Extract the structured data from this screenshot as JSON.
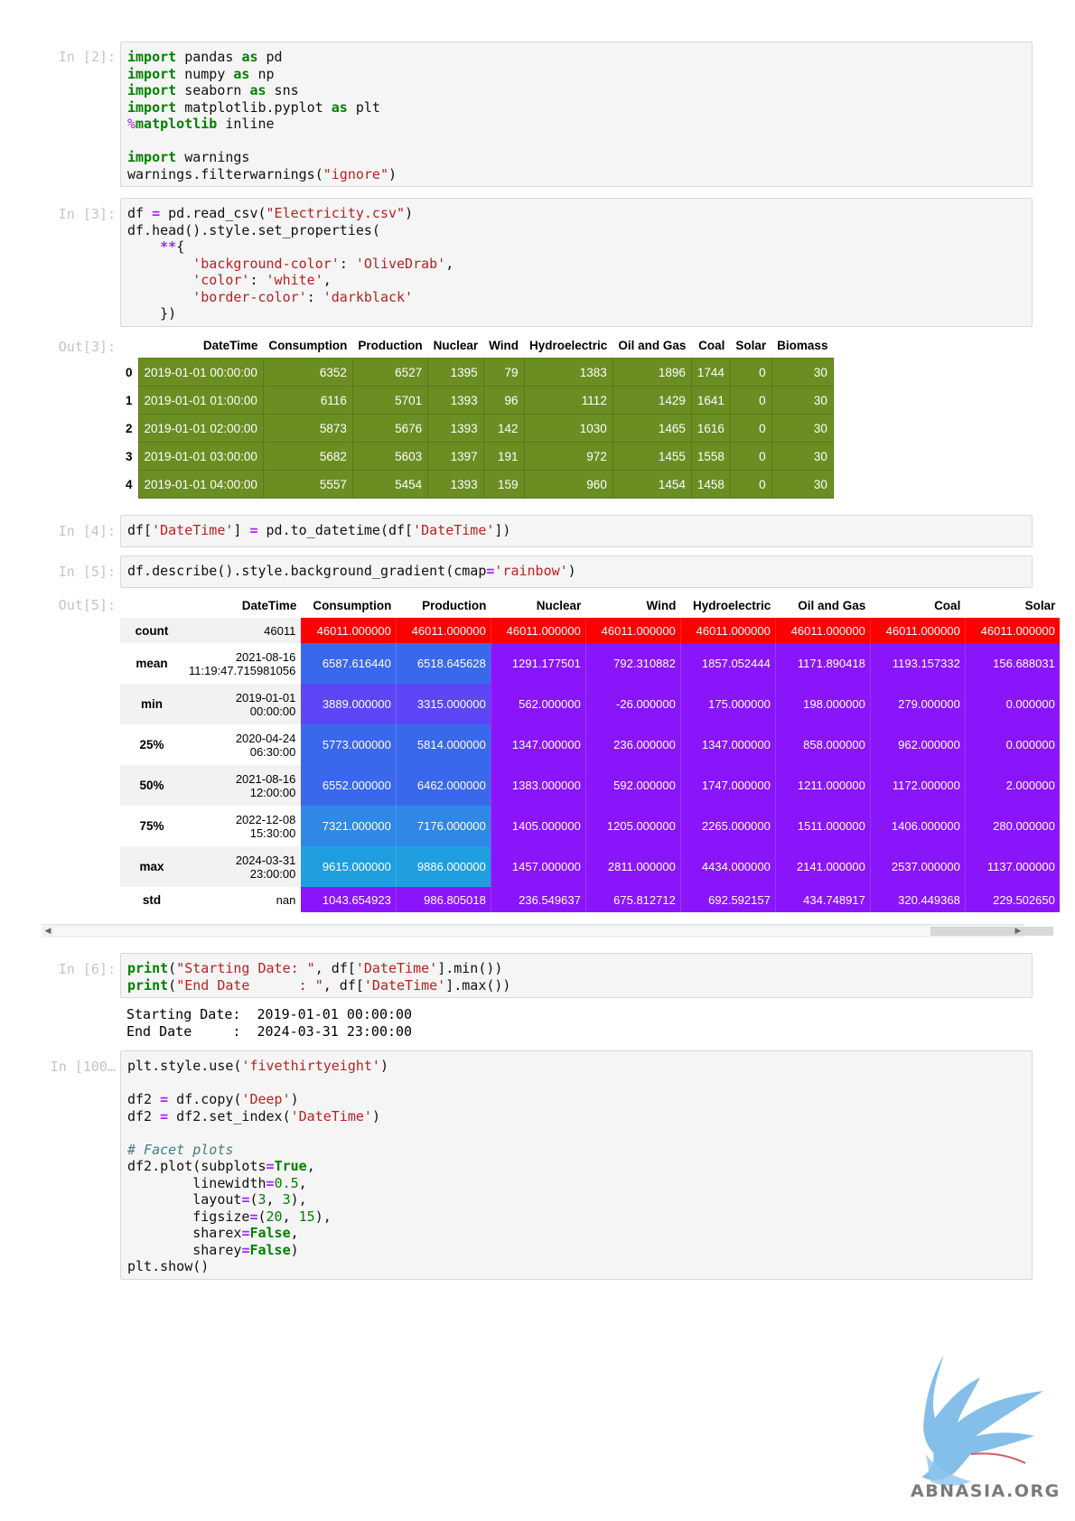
{
  "cells": {
    "in2": {
      "prompt": "In [2]:"
    },
    "in3": {
      "prompt": "In [3]:"
    },
    "out3": {
      "prompt": "Out[3]:"
    },
    "in4": {
      "prompt": "In [4]:"
    },
    "in5": {
      "prompt": "In [5]:"
    },
    "out5": {
      "prompt": "Out[5]:"
    },
    "in6": {
      "prompt": "In [6]:"
    },
    "in100": {
      "prompt": "In [100…"
    }
  },
  "head_table": {
    "columns": [
      "",
      "DateTime",
      "Consumption",
      "Production",
      "Nuclear",
      "Wind",
      "Hydroelectric",
      "Oil and Gas",
      "Coal",
      "Solar",
      "Biomass"
    ],
    "rows": [
      [
        "0",
        "2019-01-01 00:00:00",
        "6352",
        "6527",
        "1395",
        "79",
        "1383",
        "1896",
        "1744",
        "0",
        "30"
      ],
      [
        "1",
        "2019-01-01 01:00:00",
        "6116",
        "5701",
        "1393",
        "96",
        "1112",
        "1429",
        "1641",
        "0",
        "30"
      ],
      [
        "2",
        "2019-01-01 02:00:00",
        "5873",
        "5676",
        "1393",
        "142",
        "1030",
        "1465",
        "1616",
        "0",
        "30"
      ],
      [
        "3",
        "2019-01-01 03:00:00",
        "5682",
        "5603",
        "1397",
        "191",
        "972",
        "1455",
        "1558",
        "0",
        "30"
      ],
      [
        "4",
        "2019-01-01 04:00:00",
        "5557",
        "5454",
        "1393",
        "159",
        "960",
        "1454",
        "1458",
        "0",
        "30"
      ]
    ],
    "background_color": "#6b8e23",
    "text_color": "#ffffff"
  },
  "describe_table": {
    "columns": [
      "",
      "DateTime",
      "Consumption",
      "Production",
      "Nuclear",
      "Wind",
      "Hydroelectric",
      "Oil and Gas",
      "Coal",
      "Solar"
    ],
    "rows": [
      {
        "label": "count",
        "datetime": "46011",
        "values": [
          "46011.000000",
          "46011.000000",
          "46011.000000",
          "46011.000000",
          "46011.000000",
          "46011.000000",
          "46011.000000",
          "46011.000000"
        ],
        "colors": [
          "#ff0000",
          "#ff0000",
          "#ff0000",
          "#ff0000",
          "#ff0000",
          "#ff0000",
          "#ff0000",
          "#ff0000"
        ]
      },
      {
        "label": "mean",
        "datetime": "2021-08-16\n11:19:47.715981056",
        "values": [
          "6587.616440",
          "6518.645628",
          "1291.177501",
          "792.310882",
          "1857.052444",
          "1171.890418",
          "1193.157332",
          "156.688031"
        ],
        "colors": [
          "#3a68ec",
          "#3a68ec",
          "#8a15fb",
          "#8a15fb",
          "#8a15fb",
          "#8a15fb",
          "#8a15fb",
          "#8a15fb"
        ]
      },
      {
        "label": "min",
        "datetime": "2019-01-01\n00:00:00",
        "values": [
          "3889.000000",
          "3315.000000",
          "562.000000",
          "-26.000000",
          "175.000000",
          "198.000000",
          "279.000000",
          "0.000000"
        ],
        "colors": [
          "#5c46f6",
          "#5c46f6",
          "#8a15fb",
          "#8a15fb",
          "#8a15fb",
          "#8a15fb",
          "#8a15fb",
          "#8a15fb"
        ]
      },
      {
        "label": "25%",
        "datetime": "2020-04-24\n06:30:00",
        "values": [
          "5773.000000",
          "5814.000000",
          "1347.000000",
          "236.000000",
          "1347.000000",
          "858.000000",
          "962.000000",
          "0.000000"
        ],
        "colors": [
          "#3a68ec",
          "#3a68ec",
          "#8a15fb",
          "#8a15fb",
          "#8a15fb",
          "#8a15fb",
          "#8a15fb",
          "#8a15fb"
        ]
      },
      {
        "label": "50%",
        "datetime": "2021-08-16\n12:00:00",
        "values": [
          "6552.000000",
          "6462.000000",
          "1383.000000",
          "592.000000",
          "1747.000000",
          "1211.000000",
          "1172.000000",
          "2.000000"
        ],
        "colors": [
          "#3a68ec",
          "#3a68ec",
          "#8a15fb",
          "#8a15fb",
          "#8a15fb",
          "#8a15fb",
          "#8a15fb",
          "#8a15fb"
        ]
      },
      {
        "label": "75%",
        "datetime": "2022-12-08\n15:30:00",
        "values": [
          "7321.000000",
          "7176.000000",
          "1405.000000",
          "1205.000000",
          "2265.000000",
          "1511.000000",
          "1406.000000",
          "280.000000"
        ],
        "colors": [
          "#2f88e6",
          "#2f88e6",
          "#8a15fb",
          "#8a15fb",
          "#8a15fb",
          "#8a15fb",
          "#8a15fb",
          "#8a15fb"
        ]
      },
      {
        "label": "max",
        "datetime": "2024-03-31\n23:00:00",
        "values": [
          "9615.000000",
          "9886.000000",
          "1457.000000",
          "2811.000000",
          "4434.000000",
          "2141.000000",
          "2537.000000",
          "1137.000000"
        ],
        "colors": [
          "#1f9fe0",
          "#1f9fe0",
          "#8a15fb",
          "#8a15fb",
          "#8a15fb",
          "#8a15fb",
          "#8a15fb",
          "#8a15fb"
        ]
      },
      {
        "label": "std",
        "datetime": "nan",
        "values": [
          "1043.654923",
          "986.805018",
          "236.549637",
          "675.812712",
          "692.592157",
          "434.748917",
          "320.449368",
          "229.502650"
        ],
        "colors": [
          "#8a15fb",
          "#8a15fb",
          "#8a15fb",
          "#8a15fb",
          "#8a15fb",
          "#8a15fb",
          "#8a15fb",
          "#8a15fb"
        ]
      }
    ]
  },
  "print_output": {
    "line1": "Starting Date:  2019-01-01 00:00:00",
    "line2": "End Date     :  2024-03-31 23:00:00"
  },
  "watermark": {
    "text": "ABNASIA.ORG",
    "icon": "griffin-logo-icon"
  },
  "scrollbar": {
    "left_arrow": "◀",
    "right_arrow": "▶"
  }
}
